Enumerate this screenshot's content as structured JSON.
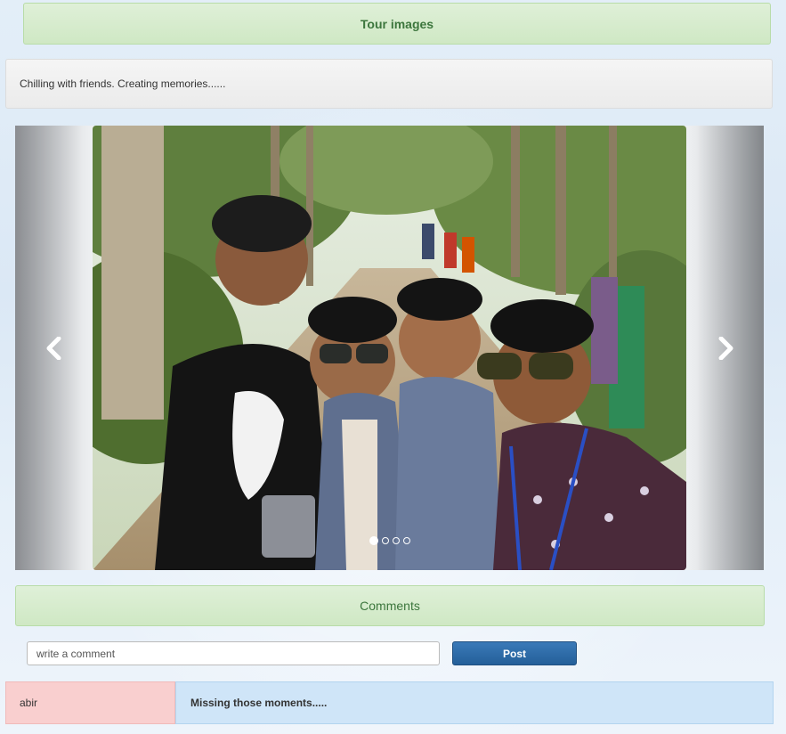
{
  "header": {
    "title": "Tour images"
  },
  "post": {
    "caption": "Chilling with friends. Creating memories......"
  },
  "carousel": {
    "image_description_icon": "photo",
    "prev_icon": "chevron-left-icon",
    "next_icon": "chevron-right-icon",
    "slide_count": 4,
    "active_slide": 1
  },
  "comments": {
    "heading": "Comments",
    "input_placeholder": "write a comment",
    "post_label": "Post",
    "items": [
      {
        "author": "abir",
        "text": "Missing those moments....."
      }
    ]
  },
  "colors": {
    "heading_bg": "#dff0d8",
    "heading_text": "#3c763d",
    "post_button": "#2f6fad",
    "author_bg": "#f9cfcf",
    "comment_bg": "#cfe5f8"
  }
}
